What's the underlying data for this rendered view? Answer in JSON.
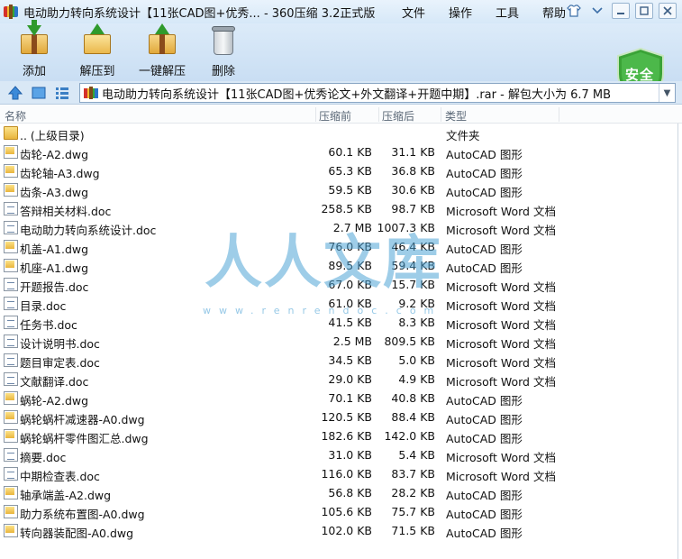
{
  "window": {
    "title": "电动助力转向系统设计【11张CAD图+优秀... - 360压缩 3.2正式版",
    "menu": [
      "文件",
      "操作",
      "工具",
      "帮助"
    ]
  },
  "toolbar": {
    "add_label": "添加",
    "extract_to_label": "解压到",
    "one_click_label": "一键解压",
    "delete_label": "删除",
    "security_badge": "安全"
  },
  "address": {
    "path": "电动助力转向系统设计【11张CAD图+优秀论文+外文翻译+开题中期】.rar - 解包大小为 6.7 MB"
  },
  "columns": {
    "name": "名称",
    "size": "压缩前",
    "compressed": "压缩后",
    "type": "类型"
  },
  "files": [
    {
      "name": ".. (上级目录)",
      "size": "",
      "compressed": "",
      "type": "文件夹",
      "icon": "folder"
    },
    {
      "name": "齿轮-A2.dwg",
      "size": "60.1 KB",
      "compressed": "31.1 KB",
      "type": "AutoCAD 图形",
      "icon": "dwg"
    },
    {
      "name": "齿轮轴-A3.dwg",
      "size": "65.3 KB",
      "compressed": "36.8 KB",
      "type": "AutoCAD 图形",
      "icon": "dwg"
    },
    {
      "name": "齿条-A3.dwg",
      "size": "59.5 KB",
      "compressed": "30.6 KB",
      "type": "AutoCAD 图形",
      "icon": "dwg"
    },
    {
      "name": "答辩相关材料.doc",
      "size": "258.5 KB",
      "compressed": "98.7 KB",
      "type": "Microsoft Word 文档",
      "icon": "doc"
    },
    {
      "name": "电动助力转向系统设计.doc",
      "size": "2.7 MB",
      "compressed": "1007.3 KB",
      "type": "Microsoft Word 文档",
      "icon": "doc"
    },
    {
      "name": "机盖-A1.dwg",
      "size": "76.0 KB",
      "compressed": "46.4 KB",
      "type": "AutoCAD 图形",
      "icon": "dwg"
    },
    {
      "name": "机座-A1.dwg",
      "size": "89.5 KB",
      "compressed": "59.4 KB",
      "type": "AutoCAD 图形",
      "icon": "dwg"
    },
    {
      "name": "开题报告.doc",
      "size": "67.0 KB",
      "compressed": "15.7 KB",
      "type": "Microsoft Word 文档",
      "icon": "doc"
    },
    {
      "name": "目录.doc",
      "size": "61.0 KB",
      "compressed": "9.2 KB",
      "type": "Microsoft Word 文档",
      "icon": "doc"
    },
    {
      "name": "任务书.doc",
      "size": "41.5 KB",
      "compressed": "8.3 KB",
      "type": "Microsoft Word 文档",
      "icon": "doc"
    },
    {
      "name": "设计说明书.doc",
      "size": "2.5 MB",
      "compressed": "809.5 KB",
      "type": "Microsoft Word 文档",
      "icon": "doc"
    },
    {
      "name": "题目审定表.doc",
      "size": "34.5 KB",
      "compressed": "5.0 KB",
      "type": "Microsoft Word 文档",
      "icon": "doc"
    },
    {
      "name": "文献翻译.doc",
      "size": "29.0 KB",
      "compressed": "4.9 KB",
      "type": "Microsoft Word 文档",
      "icon": "doc"
    },
    {
      "name": "蜗轮-A2.dwg",
      "size": "70.1 KB",
      "compressed": "40.8 KB",
      "type": "AutoCAD 图形",
      "icon": "dwg"
    },
    {
      "name": "蜗轮蜗杆减速器-A0.dwg",
      "size": "120.5 KB",
      "compressed": "88.4 KB",
      "type": "AutoCAD 图形",
      "icon": "dwg"
    },
    {
      "name": "蜗轮蜗杆零件图汇总.dwg",
      "size": "182.6 KB",
      "compressed": "142.0 KB",
      "type": "AutoCAD 图形",
      "icon": "dwg"
    },
    {
      "name": "摘要.doc",
      "size": "31.0 KB",
      "compressed": "5.4 KB",
      "type": "Microsoft Word 文档",
      "icon": "doc"
    },
    {
      "name": "中期检查表.doc",
      "size": "116.0 KB",
      "compressed": "83.7 KB",
      "type": "Microsoft Word 文档",
      "icon": "doc"
    },
    {
      "name": "轴承端盖-A2.dwg",
      "size": "56.8 KB",
      "compressed": "28.2 KB",
      "type": "AutoCAD 图形",
      "icon": "dwg"
    },
    {
      "name": "助力系统布置图-A0.dwg",
      "size": "105.6 KB",
      "compressed": "75.7 KB",
      "type": "AutoCAD 图形",
      "icon": "dwg"
    },
    {
      "name": "转向器装配图-A0.dwg",
      "size": "102.0 KB",
      "compressed": "71.5 KB",
      "type": "AutoCAD 图形",
      "icon": "dwg"
    }
  ],
  "watermark": {
    "text": "人人文库",
    "url": "www.renrendoc.com"
  }
}
